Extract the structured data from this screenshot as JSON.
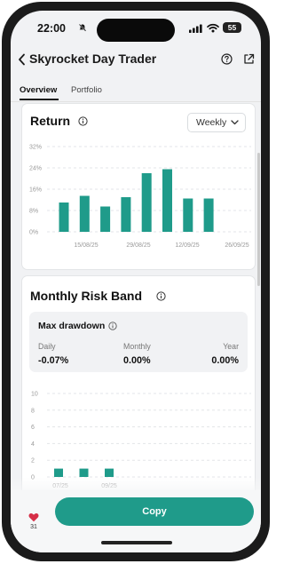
{
  "status_bar": {
    "time": "22:00",
    "battery": "55"
  },
  "header": {
    "title": "Skyrocket Day Trader"
  },
  "tabs": [
    {
      "label": "Overview"
    },
    {
      "label": "Portfolio"
    }
  ],
  "return_card": {
    "title": "Return",
    "period_select": "Weekly"
  },
  "risk_card": {
    "title": "Monthly Risk Band",
    "drawdown": {
      "title": "Max drawdown",
      "items": [
        {
          "label": "Daily",
          "value": "-0.07%"
        },
        {
          "label": "Monthly",
          "value": "0.00%"
        },
        {
          "label": "Year",
          "value": "0.00%"
        }
      ]
    }
  },
  "bottom": {
    "likes": "31",
    "copy_label": "Copy"
  },
  "colors": {
    "accent": "#1f9b8a",
    "heart": "#d62f47"
  },
  "chart_data": [
    {
      "type": "bar",
      "title": "Return",
      "ylim": [
        0,
        32
      ],
      "y_ticks": [
        "32%",
        "24%",
        "16%",
        "8%",
        "0%"
      ],
      "x_tick_labels": [
        "15/08/25",
        "29/08/25",
        "12/09/25",
        "26/09/25"
      ],
      "values": [
        11,
        13.5,
        9.5,
        13,
        22,
        23.5,
        12.5,
        12.5
      ],
      "grid": true
    },
    {
      "type": "bar",
      "title": "Monthly Risk Band",
      "ylim": [
        0,
        10
      ],
      "y_ticks": [
        "10",
        "8",
        "6",
        "4",
        "2",
        "0"
      ],
      "x_tick_labels": [
        "07/25",
        "09/25"
      ],
      "values": [
        1,
        1,
        1
      ],
      "grid": true
    }
  ]
}
